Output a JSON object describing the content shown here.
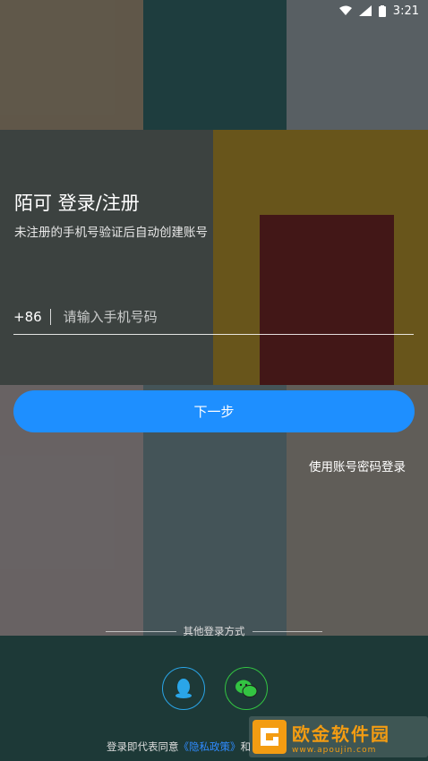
{
  "status_bar": {
    "time": "3:21"
  },
  "login": {
    "title": "陌可 登录/注册",
    "subtitle": "未注册的手机号验证后自动创建账号",
    "country_code": "+86",
    "phone_placeholder": "请输入手机号码",
    "next_label": "下一步",
    "password_login_label": "使用账号密码登录",
    "other_methods_label": "其他登录方式"
  },
  "agreement": {
    "prefix": "登录即代表同意",
    "policy": "《隐私政策》",
    "suffix": "和"
  },
  "watermark": {
    "name": "欧金软件园",
    "url": "www.apoujin.com"
  },
  "colors": {
    "primary_button": "#1e8fff",
    "qq": "#2aa5e8",
    "wechat": "#33c442",
    "link": "#2f8bff"
  }
}
